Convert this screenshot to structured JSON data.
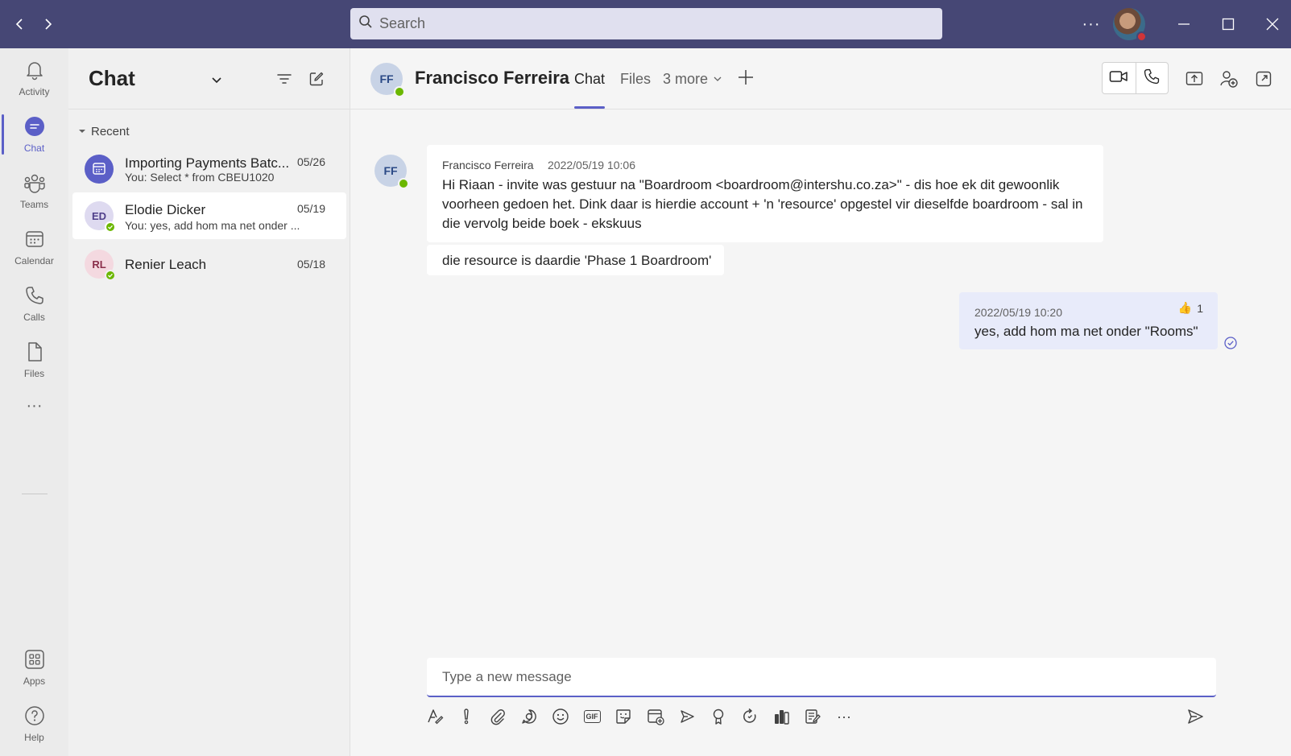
{
  "titlebar": {
    "search_placeholder": "Search",
    "more_label": "···"
  },
  "rail": {
    "items": [
      {
        "label": "Activity",
        "icon": "bell-icon"
      },
      {
        "label": "Chat",
        "icon": "chat-icon"
      },
      {
        "label": "Teams",
        "icon": "teams-icon"
      },
      {
        "label": "Calendar",
        "icon": "calendar-icon"
      },
      {
        "label": "Calls",
        "icon": "phone-icon"
      },
      {
        "label": "Files",
        "icon": "file-icon"
      }
    ],
    "more": "···",
    "apps": "Apps",
    "help": "Help"
  },
  "chatlist": {
    "title": "Chat",
    "section": "Recent",
    "items": [
      {
        "name": "Importing Payments Batc...",
        "preview": "You: Select * from CBEU1020",
        "date": "05/26",
        "avatar": "calendar-icon"
      },
      {
        "name": "Elodie Dicker",
        "preview": "You: yes, add hom ma net onder ...",
        "date": "05/19",
        "initials": "ED"
      },
      {
        "name": "Renier Leach",
        "preview": "",
        "date": "05/18",
        "initials": "RL"
      }
    ]
  },
  "conversation": {
    "initials": "FF",
    "name": "Francisco Ferreira",
    "tabs": [
      "Chat",
      "Files",
      "3 more"
    ]
  },
  "messages": [
    {
      "sender": "Francisco Ferreira",
      "time": "2022/05/19 10:06",
      "text": "Hi Riaan - invite was gestuur na \"Boardroom <boardroom@intershu.co.za>\" - dis hoe ek dit gewoonlik voorheen gedoen het. Dink daar is hierdie account + 'n 'resource' opgestel vir dieselfde boardroom - sal in die vervolg beide boek - ekskuus"
    },
    {
      "text": "die resource is daardie 'Phase 1 Boardroom'"
    },
    {
      "time": "2022/05/19 10:20",
      "text": "yes, add hom ma net onder \"Rooms\"",
      "reaction_emoji": "👍",
      "reaction_count": "1"
    }
  ],
  "compose": {
    "placeholder": "Type a new message"
  },
  "colors": {
    "titlebar": "#464775",
    "accent": "#5b5fc7",
    "presence_available": "#6bb700",
    "presence_busy": "#d13438"
  }
}
